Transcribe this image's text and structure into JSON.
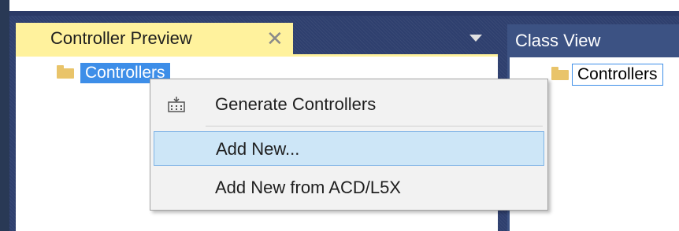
{
  "left_panel": {
    "tab_title": "Controller Preview",
    "close_glyph": "✕",
    "tree": {
      "root_label": "Controllers",
      "root_icon": "folder-icon"
    }
  },
  "right_panel": {
    "tab_title": "Class View",
    "tree": {
      "root_label": "Controllers",
      "root_icon": "folder-icon"
    }
  },
  "context_menu": {
    "items": [
      {
        "label": "Generate Controllers",
        "icon": "generate-controllers-icon"
      },
      {
        "label": "Add New..."
      },
      {
        "label": "Add New from ACD/L5X"
      }
    ]
  },
  "colors": {
    "active_tab": "#fff29d",
    "selection": "#3d8ee8",
    "hover_item": "#cde6f7",
    "frame": "#2e3f6e"
  }
}
